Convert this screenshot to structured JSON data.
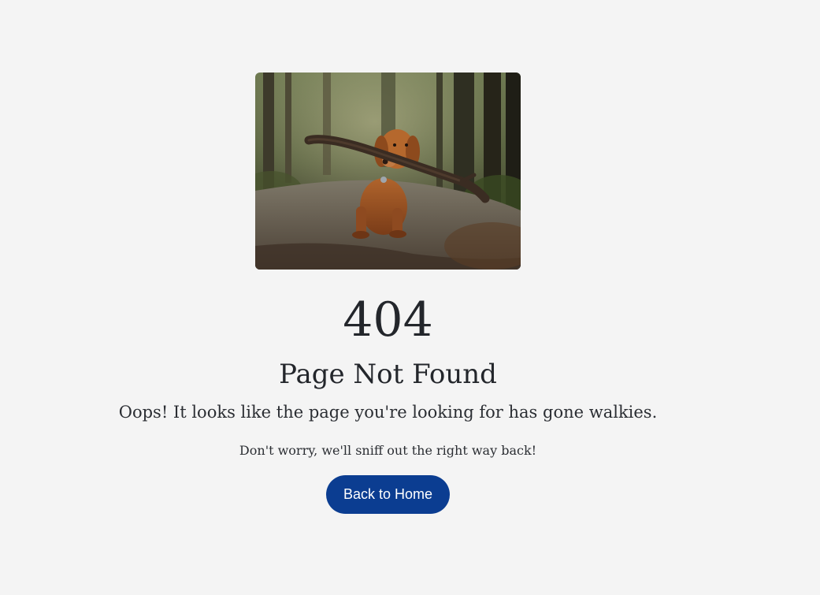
{
  "hero": {
    "image_alt": "Dog carrying a large stick on a forest path"
  },
  "error": {
    "code": "404",
    "title": "Page Not Found",
    "message": "Oops! It looks like the page you're looking for has gone walkies.",
    "submessage": "Don't worry, we'll sniff out the right way back!"
  },
  "actions": {
    "home_label": "Back to Home"
  },
  "colors": {
    "background": "#f4f4f4",
    "text": "#23262b",
    "button": "#0b3d91",
    "button_text": "#ffffff"
  }
}
